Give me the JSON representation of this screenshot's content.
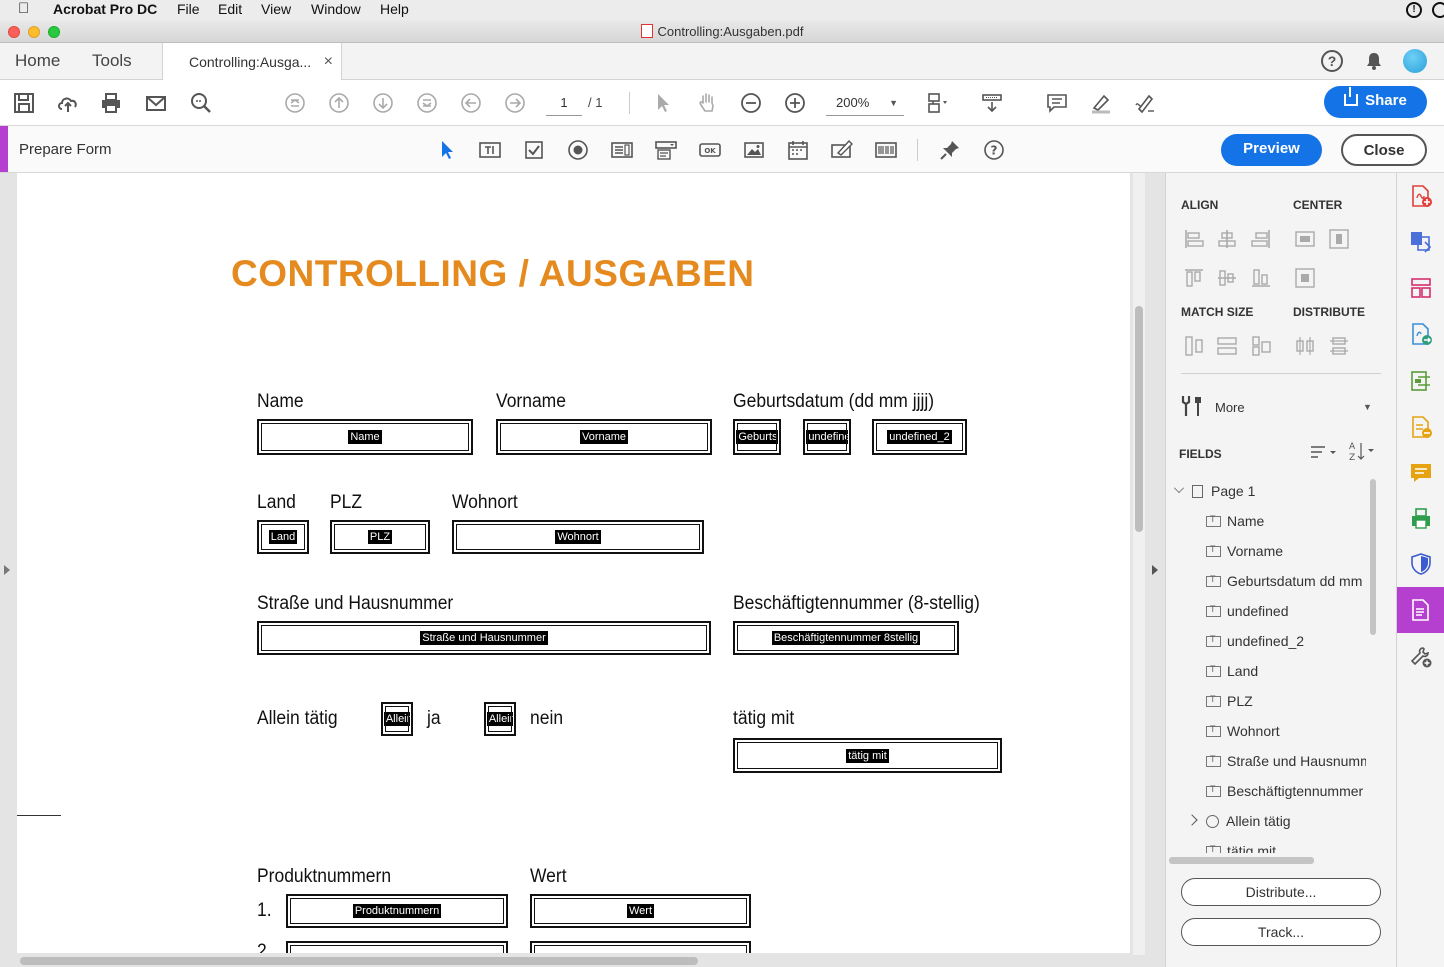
{
  "menubar": {
    "app_name": "Acrobat Pro DC",
    "items": [
      "File",
      "Edit",
      "View",
      "Window",
      "Help"
    ]
  },
  "window": {
    "title": "Controlling:Ausgaben.pdf"
  },
  "tabs": {
    "home": "Home",
    "tools": "Tools",
    "document": "Controlling:Ausga...",
    "close_glyph": "×"
  },
  "toolbar": {
    "page_current": "1",
    "page_total": "/ 1",
    "zoom": "200%",
    "share_label": "Share"
  },
  "formbar": {
    "title": "Prepare Form",
    "preview_label": "Preview",
    "close_label": "Close"
  },
  "document": {
    "heading": "CONTROLLING / AUSGABEN",
    "labels": {
      "name": "Name",
      "vorname": "Vorname",
      "geburtsdatum": "Geburtsdatum (dd mm jjjj)",
      "land": "Land",
      "plz": "PLZ",
      "wohnort": "Wohnort",
      "strasse": "Straße und Hausnummer",
      "beschaeftigt": "Beschäftigtennummer (8-stellig)",
      "allein": "Allein tätig",
      "ja": "ja",
      "nein": "nein",
      "taetig_mit": "tätig mit",
      "produktnummern": "Produktnummern",
      "wert": "Wert",
      "row1": "1.",
      "row2": "2."
    },
    "fields": {
      "name": "Name",
      "vorname": "Vorname",
      "geburts": "Geburts",
      "undefined": "undefined",
      "undefined_2": "undefined_2",
      "land": "Land",
      "plz": "PLZ",
      "wohnort": "Wohnort",
      "strasse": "Straße und Hausnummer",
      "beschaeftigt": "Beschäftigtennummer 8stellig",
      "allein1": "Allein",
      "allein2": "Allein",
      "taetig": "tätig mit",
      "produkt": "Produktnummern",
      "wert": "Wert"
    }
  },
  "panel": {
    "align": "ALIGN",
    "center": "CENTER",
    "match_size": "MATCH SIZE",
    "distribute": "DISTRIBUTE",
    "more": "More",
    "fields": "FIELDS",
    "tree": {
      "page": "Page 1",
      "items": [
        "Name",
        "Vorname",
        "Geburtsdatum dd mm",
        "undefined",
        "undefined_2",
        "Land",
        "PLZ",
        "Wohnort",
        "Straße und Hausnumm",
        "Beschäftigtennummer"
      ],
      "group": "Allein tätig",
      "partial": "tätig mit"
    },
    "distribute_btn": "Distribute...",
    "track_btn": "Track..."
  },
  "colors": {
    "heading_orange": "#E58A1F",
    "accent_blue": "#1473E6",
    "form_purple": "#B53FCF"
  }
}
